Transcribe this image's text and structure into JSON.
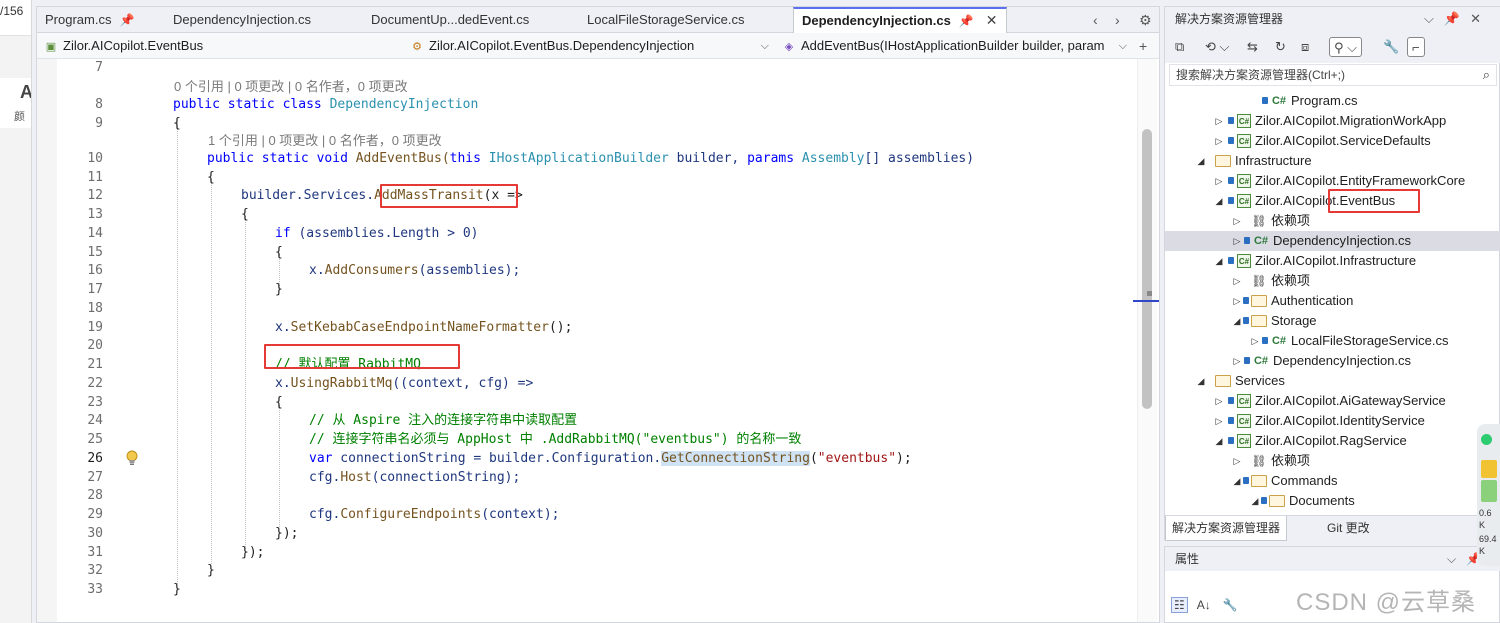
{
  "left_strip": {
    "top_text": "/156",
    "big_letter": "A",
    "small_text": "颜"
  },
  "tabs": [
    {
      "label": "Program.cs",
      "pinned": true,
      "active": false
    },
    {
      "label": "DependencyInjection.cs",
      "active": false
    },
    {
      "label": "DocumentUp...dedEvent.cs",
      "active": false
    },
    {
      "label": "LocalFileStorageService.cs",
      "active": false
    },
    {
      "label": "DependencyInjection.cs",
      "pinned": true,
      "active": true
    }
  ],
  "navbar": {
    "project": "Zilor.AICopilot.EventBus",
    "class": "Zilor.AICopilot.EventBus.DependencyInjection",
    "member": "AddEventBus(IHostApplicationBuilder builder, param"
  },
  "code_lens": {
    "class_refs": "0 个引用 | 0 项更改 | 0 名作者，0 项更改",
    "method_refs": "1 个引用 | 0 项更改 | 0 名作者，0 项更改"
  },
  "line_numbers": [
    "7",
    "8",
    "9",
    "10",
    "11",
    "12",
    "13",
    "14",
    "15",
    "16",
    "17",
    "18",
    "19",
    "20",
    "21",
    "22",
    "23",
    "24",
    "25",
    "26",
    "27",
    "28",
    "29",
    "30",
    "31",
    "32",
    "33"
  ],
  "current_line": "26",
  "code": {
    "l8": [
      "public",
      "static",
      "class",
      "DependencyInjection"
    ],
    "l9": "{",
    "l10": [
      "public",
      "static",
      "void",
      "AddEventBus(",
      "this",
      "IHostApplicationBuilder",
      "builder,",
      "params",
      "Assembly",
      "[] assemblies)"
    ],
    "l11": "{",
    "l12": [
      "builder.Services.",
      "AddMassTransit",
      "(x =>"
    ],
    "l13": "{",
    "l14": [
      "if",
      " (assemblies.Length > 0)"
    ],
    "l15": "{",
    "l16": [
      "x.",
      "AddConsumers",
      "(assemblies);"
    ],
    "l17": "}",
    "l19": [
      "x.",
      "SetKebabCaseEndpointNameFormatter",
      "();"
    ],
    "l21": "// 默认配置 RabbitMQ",
    "l22": [
      "x.",
      "UsingRabbitMq",
      "((context, cfg) =>"
    ],
    "l23": "{",
    "l24": "// 从 Aspire 注入的连接字符串中读取配置",
    "l25": "// 连接字符串名必须与 AppHost 中 .AddRabbitMQ(\"eventbus\") 的名称一致",
    "l26": [
      "var",
      " connectionString = builder.Configuration.",
      "GetConnectionString",
      "(",
      "\"eventbus\"",
      ");"
    ],
    "l27": [
      "cfg.",
      "Host",
      "(connectionString);"
    ],
    "l29": [
      "cfg.",
      "ConfigureEndpoints",
      "(context);"
    ],
    "l30": "});",
    "l31": "});",
    "l32": "}",
    "l33": "}"
  },
  "solution_explorer": {
    "title": "解决方案资源管理器",
    "search_placeholder": "搜索解决方案资源管理器(Ctrl+;)",
    "tree": [
      {
        "label": "Program.cs",
        "type": "cs",
        "level": 4
      },
      {
        "label": "Zilor.AICopilot.MigrationWorkApp",
        "type": "proj",
        "level": 2,
        "state": "collapsed"
      },
      {
        "label": "Zilor.AICopilot.ServiceDefaults",
        "type": "proj",
        "level": 2,
        "state": "collapsed"
      },
      {
        "label": "Infrastructure",
        "type": "folder",
        "level": 1,
        "state": "expanded"
      },
      {
        "label": "Zilor.AICopilot.EntityFrameworkCore",
        "type": "proj",
        "level": 2,
        "state": "collapsed"
      },
      {
        "label": "Zilor.AICopilot.EventBus",
        "type": "proj",
        "level": 2,
        "state": "expanded"
      },
      {
        "label": "依赖项",
        "type": "dep",
        "level": 3,
        "state": "collapsed"
      },
      {
        "label": "DependencyInjection.cs",
        "type": "cs",
        "level": 3,
        "state": "collapsed",
        "selected": true
      },
      {
        "label": "Zilor.AICopilot.Infrastructure",
        "type": "proj",
        "level": 2,
        "state": "expanded"
      },
      {
        "label": "依赖项",
        "type": "dep",
        "level": 3,
        "state": "collapsed"
      },
      {
        "label": "Authentication",
        "type": "folder",
        "level": 3,
        "state": "collapsed"
      },
      {
        "label": "Storage",
        "type": "folder",
        "level": 3,
        "state": "expanded"
      },
      {
        "label": "LocalFileStorageService.cs",
        "type": "cs",
        "level": 4,
        "state": "collapsed"
      },
      {
        "label": "DependencyInjection.cs",
        "type": "cs",
        "level": 3,
        "state": "collapsed"
      },
      {
        "label": "Services",
        "type": "folder",
        "level": 1,
        "state": "expanded"
      },
      {
        "label": "Zilor.AICopilot.AiGatewayService",
        "type": "proj",
        "level": 2,
        "state": "collapsed"
      },
      {
        "label": "Zilor.AICopilot.IdentityService",
        "type": "proj",
        "level": 2,
        "state": "collapsed"
      },
      {
        "label": "Zilor.AICopilot.RagService",
        "type": "proj",
        "level": 2,
        "state": "expanded"
      },
      {
        "label": "依赖项",
        "type": "dep",
        "level": 3,
        "state": "collapsed"
      },
      {
        "label": "Commands",
        "type": "folder",
        "level": 3,
        "state": "expanded"
      },
      {
        "label": "Documents",
        "type": "folder",
        "level": 4,
        "state": "expanded"
      }
    ],
    "bottom_tabs": [
      "解决方案资源管理器",
      "Git 更改"
    ]
  },
  "properties": {
    "title": "属性"
  },
  "perf_widget": {
    "value1": "0.6",
    "value2": "K",
    "value3": "69.4",
    "value4": "K"
  },
  "watermark": "CSDN @云草桑",
  "colors": {
    "keyword": "#0000ff",
    "type": "#2b91af",
    "comment": "#008000",
    "string": "#a31515",
    "highlight_box": "#e53935",
    "accent": "#5a6ff0"
  }
}
